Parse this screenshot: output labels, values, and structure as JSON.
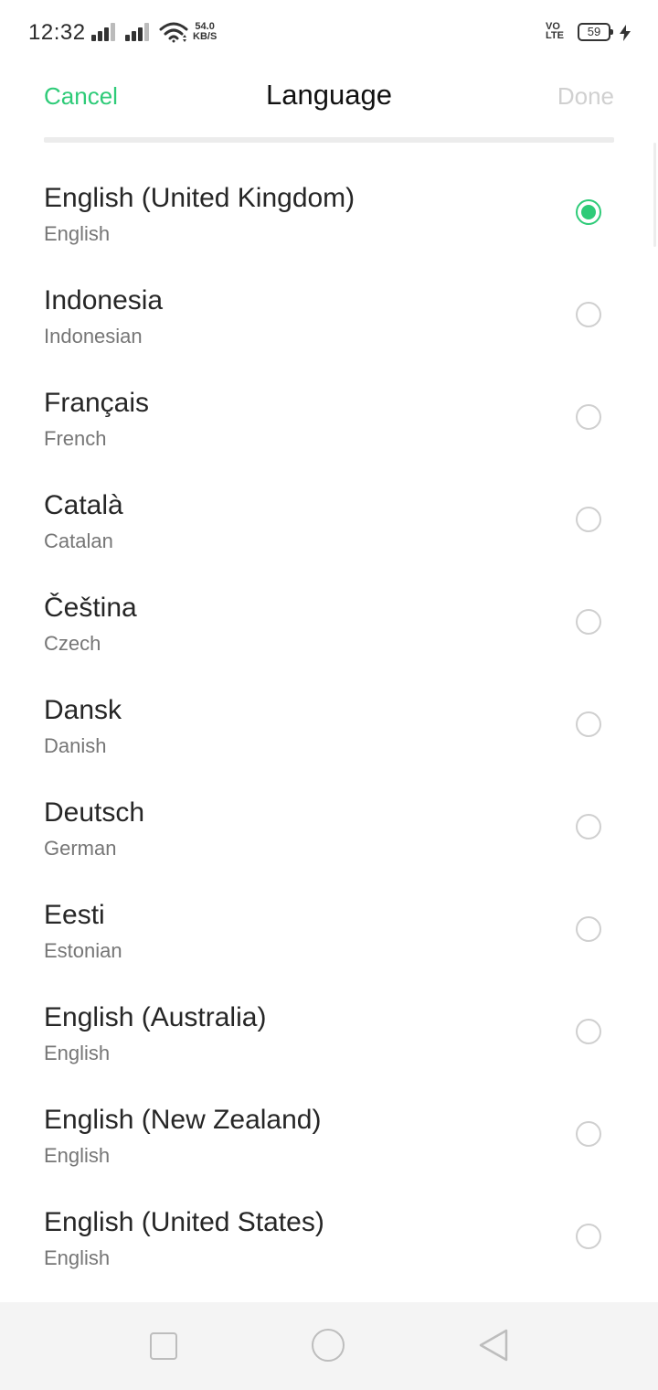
{
  "status_bar": {
    "time": "12:32",
    "net_speed_value": "54.0",
    "net_speed_unit": "KB/S",
    "volte_top": "VO",
    "volte_bottom": "LTE",
    "battery": "59"
  },
  "header": {
    "cancel_label": "Cancel",
    "title": "Language",
    "done_label": "Done"
  },
  "colors": {
    "accent": "#2ecb78",
    "disabled": "#d0d0d0"
  },
  "languages": [
    {
      "name": "English (United Kingdom)",
      "sub": "English",
      "selected": true
    },
    {
      "name": "Indonesia",
      "sub": "Indonesian",
      "selected": false
    },
    {
      "name": "Français",
      "sub": "French",
      "selected": false
    },
    {
      "name": "Català",
      "sub": "Catalan",
      "selected": false
    },
    {
      "name": "Čeština",
      "sub": "Czech",
      "selected": false
    },
    {
      "name": "Dansk",
      "sub": "Danish",
      "selected": false
    },
    {
      "name": "Deutsch",
      "sub": "German",
      "selected": false
    },
    {
      "name": "Eesti",
      "sub": "Estonian",
      "selected": false
    },
    {
      "name": "English (Australia)",
      "sub": "English",
      "selected": false
    },
    {
      "name": "English (New Zealand)",
      "sub": "English",
      "selected": false
    },
    {
      "name": "English (United States)",
      "sub": "English",
      "selected": false
    }
  ],
  "nav_icons": {
    "recents": "square-icon",
    "home": "circle-icon",
    "back": "triangle-back-icon"
  }
}
